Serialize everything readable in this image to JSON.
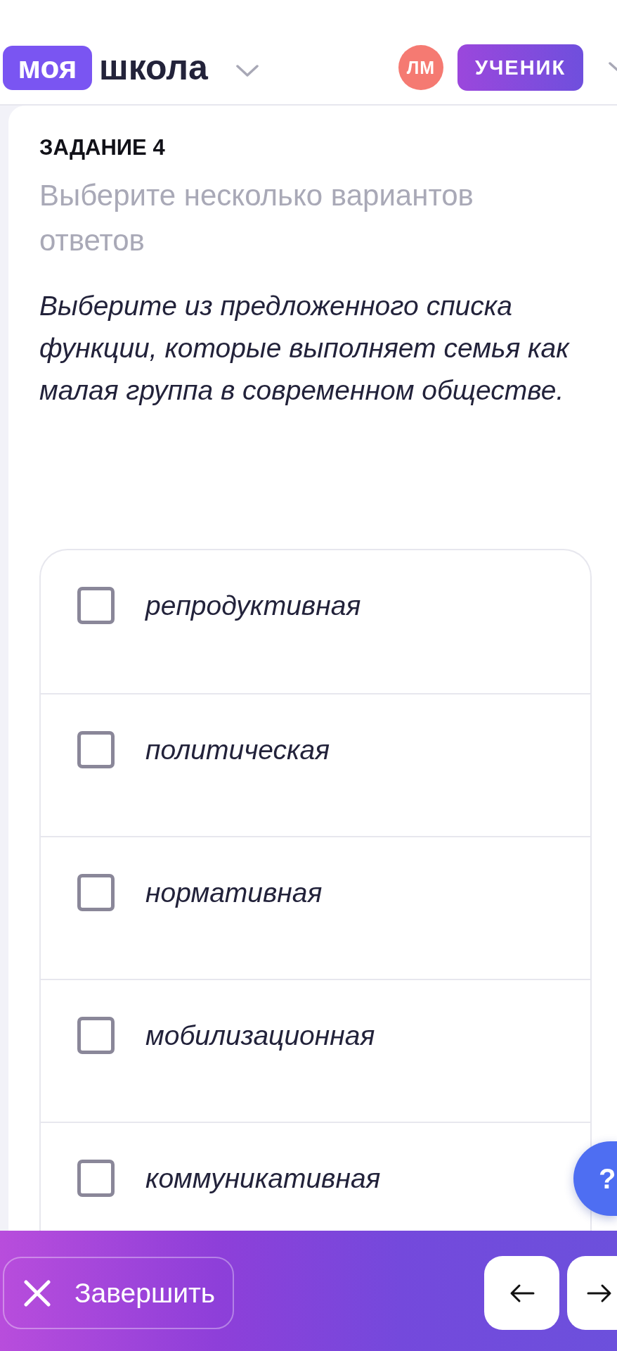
{
  "header": {
    "logo": {
      "badge": "моя",
      "text": "школа"
    },
    "avatar": "ЛМ",
    "role": "УЧЕНИК"
  },
  "task": {
    "number": "ЗАДАНИЕ 4",
    "hint": "Выберите несколько вариантов ответов",
    "question": "Выберите из предложенного списка функции, которые выполняет семья как малая группа в современном обществе."
  },
  "options": [
    {
      "label": "репродуктивная",
      "checked": false
    },
    {
      "label": "политическая",
      "checked": false
    },
    {
      "label": "нормативная",
      "checked": false
    },
    {
      "label": "мобилизационная",
      "checked": false
    },
    {
      "label": "коммуникативная",
      "checked": false
    }
  ],
  "help_button": {
    "label": "?"
  },
  "footer": {
    "finish": "Завершить"
  }
}
